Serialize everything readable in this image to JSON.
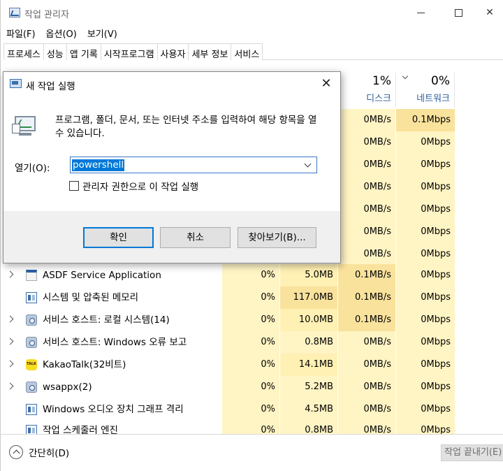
{
  "window": {
    "title": "작업 관리자"
  },
  "menu": [
    "파일(F)",
    "옵션(O)",
    "보기(V)"
  ],
  "tabs": [
    "프로세스",
    "성능",
    "앱 기록",
    "시작프로그램",
    "사용자",
    "세부 정보",
    "서비스"
  ],
  "columns": {
    "disk": {
      "pct": "1%",
      "name": "디스크"
    },
    "network": {
      "pct": "0%",
      "name": "네트워크"
    }
  },
  "hidden_rows": [
    {
      "disk": "0MB/s",
      "net": "0.1Mbps"
    },
    {
      "disk": "0MB/s",
      "net": "0Mbps"
    },
    {
      "disk": "0MB/s",
      "net": "0Mbps"
    },
    {
      "disk": "0MB/s",
      "net": "0Mbps"
    },
    {
      "disk": "0MB/s",
      "net": "0Mbps"
    },
    {
      "disk": "0MB/s",
      "net": "0Mbps"
    },
    {
      "disk": "0MB/s",
      "net": "0Mbps"
    }
  ],
  "processes": [
    {
      "name": "ASDF Service Application",
      "icon": "asdf-icon",
      "cpu": "0%",
      "mem": "5.0MB",
      "disk": "0.1MB/s",
      "net": "0Mbps"
    },
    {
      "name": "시스템 및 압축된 메모리",
      "icon": "window-icon",
      "cpu": "0%",
      "mem": "117.0MB",
      "disk": "0.1MB/s",
      "net": "0Mbps"
    },
    {
      "name": "서비스 호스트: 로컬 시스템(14)",
      "icon": "gear-icon",
      "cpu": "0%",
      "mem": "10.0MB",
      "disk": "0.1MB/s",
      "net": "0Mbps"
    },
    {
      "name": "서비스 호스트: Windows 오류 보고",
      "icon": "gear-icon",
      "cpu": "0%",
      "mem": "0.8MB",
      "disk": "0MB/s",
      "net": "0Mbps"
    },
    {
      "name": "KakaoTalk(32비트)",
      "icon": "kakaotalk-icon",
      "cpu": "0%",
      "mem": "14.1MB",
      "disk": "0MB/s",
      "net": "0Mbps"
    },
    {
      "name": "wsappx(2)",
      "icon": "gear-icon",
      "cpu": "0%",
      "mem": "5.2MB",
      "disk": "0MB/s",
      "net": "0Mbps"
    },
    {
      "name": "Windows 오디오 장치 그래프 격리",
      "icon": "window-icon",
      "cpu": "0%",
      "mem": "4.5MB",
      "disk": "0MB/s",
      "net": "0Mbps"
    },
    {
      "name": "작업 스케줄러 엔진",
      "icon": "window-icon",
      "cpu": "0%",
      "mem": "0.8MB",
      "disk": "0MB/s",
      "net": "0Mbps"
    }
  ],
  "footer": {
    "simple_label": "간단히(D)",
    "end_task": "작업 끝내기(E)"
  },
  "run_dialog": {
    "title": "새 작업 실행",
    "description": "프로그램, 폴더, 문서, 또는 인터넷 주소를 입력하여 해당 항목을 열 수 있습니다.",
    "open_label": "열기(O):",
    "input_value": "powershell",
    "admin_checkbox_label": "관리자 권한으로 이 작업 실행",
    "admin_checked": false,
    "ok_label": "확인",
    "cancel_label": "취소",
    "browse_label": "찾아보기(B)..."
  }
}
